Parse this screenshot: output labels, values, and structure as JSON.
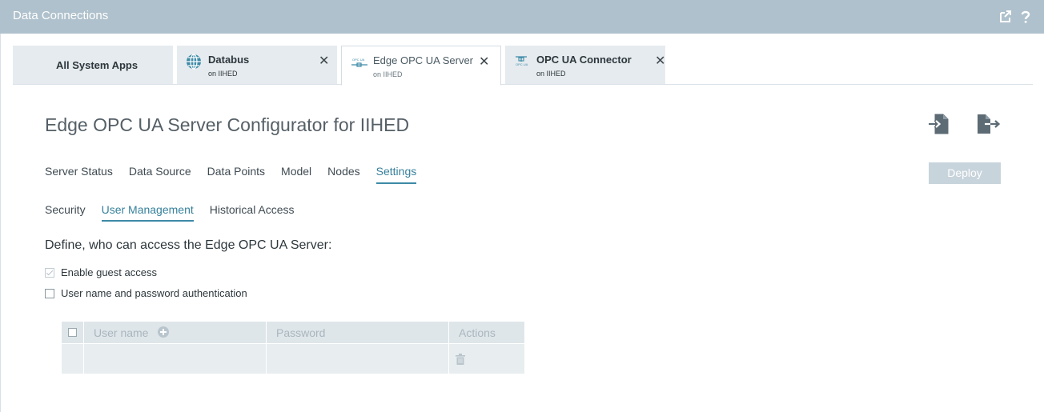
{
  "window": {
    "title": "Data Connections",
    "icons": [
      "external-link-icon",
      "help-icon"
    ]
  },
  "tabs": [
    {
      "label": "All System Apps",
      "sub": "",
      "icon": "",
      "active": false
    },
    {
      "label": "Databus",
      "sub": "on IIHED",
      "icon": "globe-network-icon",
      "active": false
    },
    {
      "label": "Edge OPC UA Server",
      "sub": "on IIHED",
      "icon": "opc-ua-server-icon",
      "active": true
    },
    {
      "label": "OPC UA Connector",
      "sub": "on IIHED",
      "icon": "opc-ua-connector-icon",
      "active": false
    }
  ],
  "close_glyph": "✕",
  "page": {
    "title": "Edge OPC UA Server Configurator for IIHED",
    "import_icon": "import-icon",
    "export_icon": "export-icon"
  },
  "main_nav": {
    "items": [
      "Server Status",
      "Data Source",
      "Data Points",
      "Model",
      "Nodes",
      "Settings"
    ],
    "active": "Settings"
  },
  "deploy_label": "Deploy",
  "sub_nav": {
    "items": [
      "Security",
      "User Management",
      "Historical Access"
    ],
    "active": "User Management"
  },
  "user_management": {
    "heading": "Define, who can access the Edge OPC UA Server:",
    "options": [
      {
        "label": "Enable guest access",
        "checked": true,
        "disabled": true
      },
      {
        "label": "User name and password authentication",
        "checked": false,
        "disabled": false
      }
    ]
  },
  "users_table": {
    "columns": [
      "User name",
      "Password",
      "Actions"
    ],
    "rows": [
      {
        "user_name": "",
        "password": "",
        "actions": [
          "trash-icon"
        ]
      }
    ]
  },
  "colors": {
    "titlebar": "#afc1cc",
    "accent": "#3d8aa6",
    "deploy_disabled": "#c8d4dc"
  }
}
